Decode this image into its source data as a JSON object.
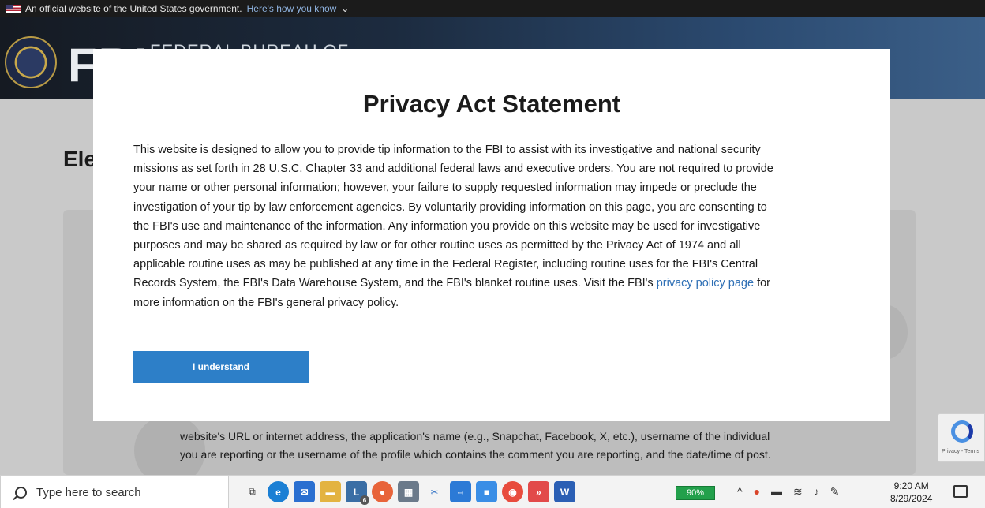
{
  "gov_banner": {
    "text": "An official website of the United States government.",
    "link": "Here's how you know"
  },
  "header": {
    "logo": "FBI",
    "full_name": "FEDERAL BUREAU OF"
  },
  "page": {
    "title": "Ele",
    "background_text": [
      "website's URL or internet address, the application's name (e.g., Snapchat, Facebook, X, etc.), username of the individual",
      "you are reporting or the username of the profile which contains the comment you are reporting, and the date/time of post."
    ],
    "recaptcha_text": "Privacy - Terms"
  },
  "modal": {
    "title": "Privacy Act Statement",
    "lines": [
      "This website is designed to allow you to provide tip information to the FBI to assist with its investigative and national security",
      "missions as set forth in 28 U.S.C. Chapter 33 and additional federal laws and executive orders. You are not required to provide",
      "your name or other personal information; however, your failure to supply requested information may impede or preclude the",
      "investigation of your tip by law enforcement agencies. By voluntarily providing information on this page, you are consenting to",
      "the FBI's use and maintenance of the information. Any information you provide on this website may be used for investigative",
      "purposes and may be shared as required by law or for other routine uses as permitted by the Privacy Act of 1974 and all",
      "applicable routine uses as may be published at any time in the Federal Register, including routine uses for the FBI's Central",
      "Records System, the FBI's Data Warehouse System, and the FBI's blanket routine uses. Visit the FBI's"
    ],
    "link_text": "privacy policy page",
    "link_suffix": " for",
    "last_line": "more information on the FBI's general privacy policy.",
    "button_label": "I understand"
  },
  "taskbar": {
    "search_placeholder": "Type here to search",
    "battery": "90%",
    "time": "9:20 AM",
    "date": "8/29/2024",
    "badge_count": "6"
  },
  "colors": {
    "accent": "#2d7fc8",
    "link": "#2e6fb5"
  }
}
